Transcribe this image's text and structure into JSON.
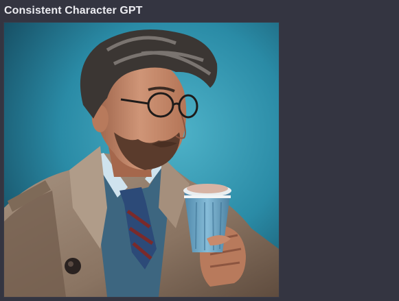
{
  "message": {
    "author_name": "Consistent Character GPT"
  },
  "generated_image": {
    "alt": "Man in glasses and tweed coat sipping from a blue paper coffee cup",
    "colors": {
      "background": "#2a8ba6",
      "coat": "#9a8370",
      "hair": "#3b3633",
      "skin": "#c08466",
      "cup": "#6ea6c7",
      "tie": "#2c4a78"
    }
  },
  "theme": {
    "page_background": "#343541",
    "title_color": "#ececf1"
  }
}
